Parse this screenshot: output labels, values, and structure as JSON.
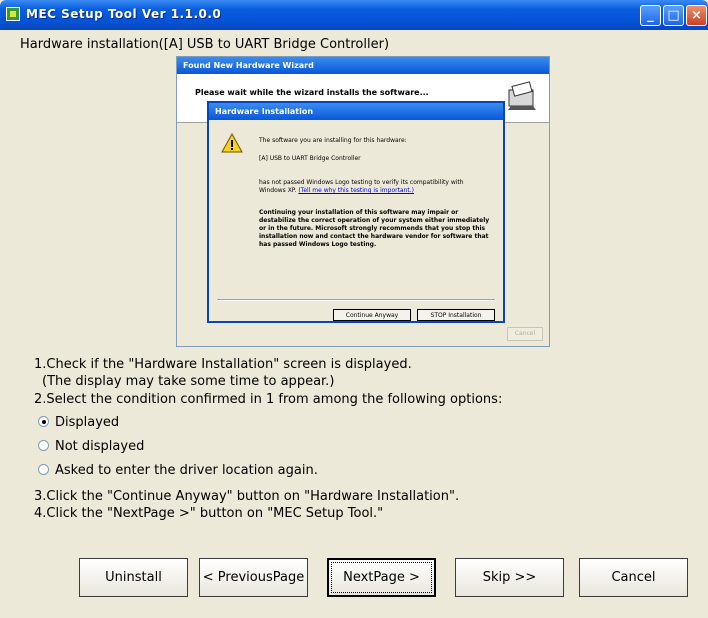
{
  "window": {
    "title": "MEC Setup Tool  Ver 1.1.0.0",
    "controls": {
      "minimize": "_",
      "maximize": "□",
      "close": "×"
    }
  },
  "main_label": "Hardware installation([A] USB to UART Bridge Controller)",
  "screenshot": {
    "found_hardware_title": "Found New Hardware Wizard",
    "wait_text": "Please wait while the wizard installs the software...",
    "dialog": {
      "title": "Hardware Installation",
      "line1": "The software you are installing for this hardware:",
      "line2": "[A] USB to UART Bridge Controller",
      "line3_pre": "has not passed Windows Logo testing to verify its compatibility with Windows XP.",
      "line3_link": "(Tell me why this testing is important.)",
      "bold_text": "Continuing your installation of this software may impair or destabilize the correct operation of your system either immediately or in the future. Microsoft strongly recommends that you stop this installation now and contact the hardware vendor for software that has passed Windows Logo testing.",
      "continue_label": "Continue Anyway",
      "stop_label": "STOP Installation"
    },
    "grey_button": "Cancel"
  },
  "instructions": {
    "step1": "1.Check if the \"Hardware Installation\" screen is displayed.",
    "step1_note": "(The display may take some time to appear.)",
    "step2": "2.Select the condition confirmed in 1 from among the following options:",
    "options": [
      {
        "label": "Displayed",
        "selected": true
      },
      {
        "label": "Not displayed",
        "selected": false
      },
      {
        "label": "Asked to enter the driver location again.",
        "selected": false
      }
    ],
    "step3": "3.Click the \"Continue Anyway\" button on \"Hardware Installation\".",
    "step4": "4.Click the \"NextPage >\" button on \"MEC Setup Tool.\""
  },
  "buttons": {
    "uninstall": "Uninstall",
    "previous": "< PreviousPage",
    "next": "NextPage >",
    "skip": "Skip >>",
    "cancel": "Cancel"
  },
  "colors": {
    "titlebar": "#0453d8",
    "window_bg": "#ece9d8",
    "close_button": "#c8402a"
  }
}
